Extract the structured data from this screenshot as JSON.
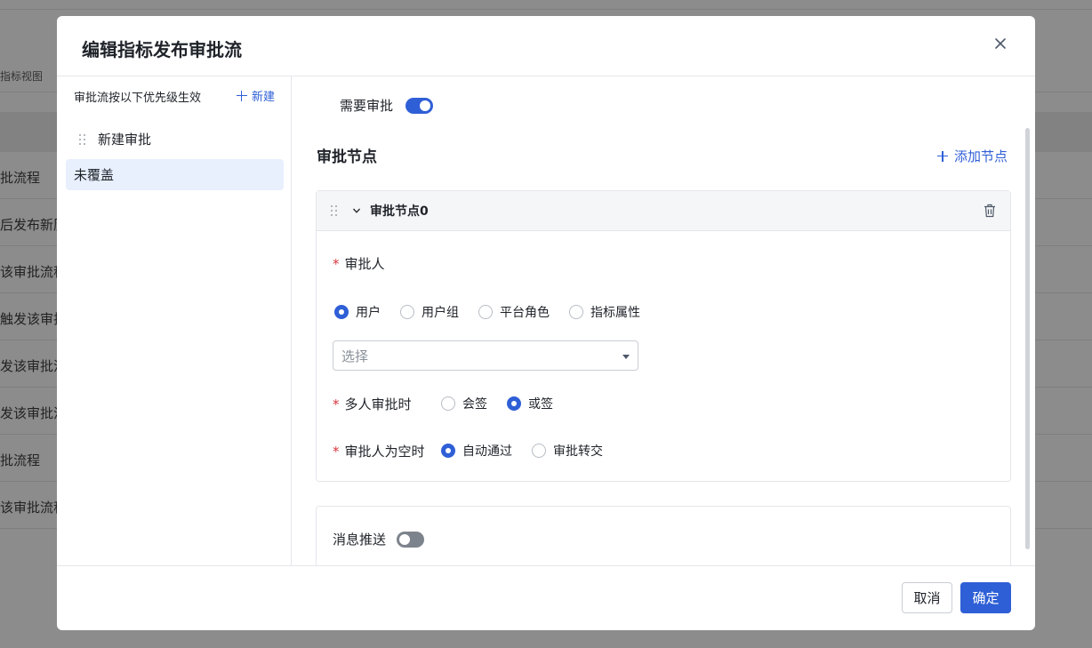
{
  "background": {
    "tab_label": "指标视图",
    "rows": [
      "批流程",
      "后发布新历",
      "该审批流程",
      "触发该审批",
      "发该审批流",
      "发该审批流",
      "批流程",
      "该审批流程"
    ]
  },
  "modal": {
    "title": "编辑指标发布审批流",
    "close_icon": "close-icon"
  },
  "left_panel": {
    "hint": "审批流按以下优先级生效",
    "new_label": "新建",
    "items": [
      {
        "label": "新建审批",
        "selected": false
      },
      {
        "label": "未覆盖",
        "selected": true
      }
    ]
  },
  "right_panel": {
    "need_approval_label": "需要审批",
    "need_approval_on": true,
    "section_title": "审批节点",
    "add_node_label": "添加节点",
    "node": {
      "title": "审批节点0",
      "approver_label": "审批人",
      "approver_types": [
        "用户",
        "用户组",
        "平台角色",
        "指标属性"
      ],
      "approver_type_selected": "用户",
      "select_placeholder": "选择",
      "multi_label": "多人审批时",
      "multi_options": [
        "会签",
        "或签"
      ],
      "multi_selected": "或签",
      "empty_label": "审批人为空时",
      "empty_options": [
        "自动通过",
        "审批转交"
      ],
      "empty_selected": "自动通过"
    },
    "message_push_label": "消息推送",
    "message_push_on": false
  },
  "footer": {
    "cancel_label": "取消",
    "ok_label": "确定"
  },
  "colors": {
    "accent": "#2f5fd6",
    "required": "#d9363e",
    "selected_item_bg": "#e8effd"
  }
}
